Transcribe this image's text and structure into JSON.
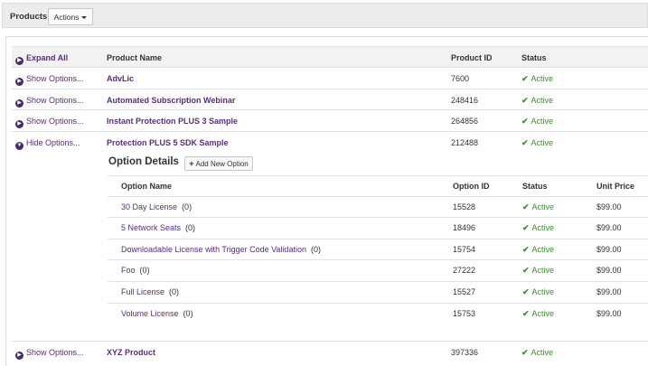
{
  "topbar": {
    "title": "Products",
    "actions_label": "Actions"
  },
  "table": {
    "expand_all": "Expand All",
    "headers": {
      "product_name": "Product Name",
      "product_id": "Product ID",
      "status": "Status"
    },
    "products": [
      {
        "toggle": "Show Options...",
        "name": "AdvLic",
        "id": "7600",
        "status": "Active"
      },
      {
        "toggle": "Show Options...",
        "name": "Automated Subscription Webinar",
        "id": "248416",
        "status": "Active"
      },
      {
        "toggle": "Show Options...",
        "name": "Instant Protection PLUS 3 Sample",
        "id": "264856",
        "status": "Active"
      },
      {
        "toggle": "Hide Options...",
        "name": "Protection PLUS 5 SDK Sample",
        "id": "212488",
        "status": "Active"
      },
      {
        "toggle": "Show Options...",
        "name": "XYZ Product",
        "id": "397336",
        "status": "Active"
      }
    ]
  },
  "options": {
    "title": "Option Details",
    "add_label": "Add New Option",
    "headers": {
      "option_name": "Option Name",
      "option_id": "Option ID",
      "status": "Status",
      "unit_price": "Unit Price"
    },
    "rows": [
      {
        "name": "30 Day License",
        "count": "(0)",
        "id": "15528",
        "status": "Active",
        "price": "$99.00"
      },
      {
        "name": "5 Network Seats",
        "count": "(0)",
        "id": "18496",
        "status": "Active",
        "price": "$99.00"
      },
      {
        "name": "Downloadable License with Trigger Code Validation",
        "count": "(0)",
        "id": "15754",
        "status": "Active",
        "price": "$99.00"
      },
      {
        "name": "Foo",
        "count": "(0)",
        "id": "27222",
        "status": "Active",
        "price": "$99.00"
      },
      {
        "name": "Full License",
        "count": "(0)",
        "id": "15527",
        "status": "Active",
        "price": "$99.00"
      },
      {
        "name": "Volume License",
        "count": "(0)",
        "id": "15753",
        "status": "Active",
        "price": "$99.00"
      }
    ]
  },
  "colors": {
    "link": "#5a2e78",
    "active": "#3c8f2e",
    "header_bg": "#f2f2f2"
  },
  "icons": {
    "expand": "circle-chevron-right-icon",
    "collapse": "circle-chevron-down-icon",
    "status": "checkmark-icon",
    "add": "plus-icon"
  }
}
